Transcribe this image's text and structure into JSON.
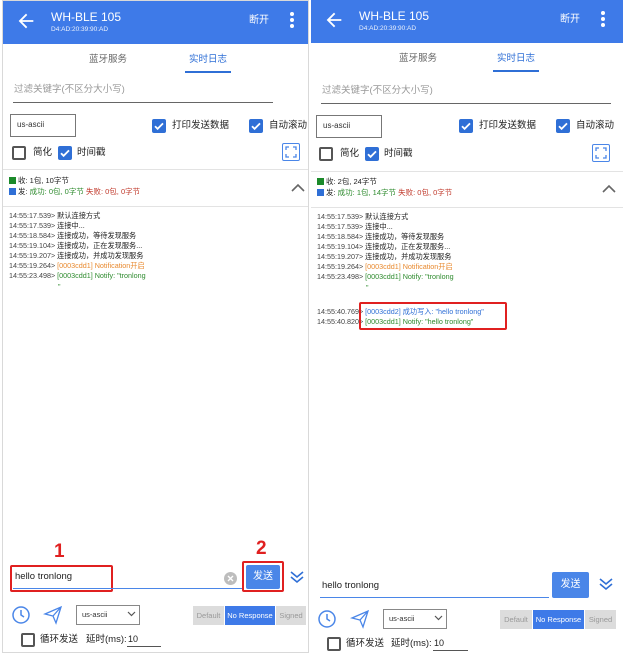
{
  "device": {
    "name": "WH-BLE 105",
    "mac": "D4:AD:20:39:90:AD",
    "disconnect_label": "断开"
  },
  "tabs": [
    {
      "label": "蓝牙服务"
    },
    {
      "label": "实时日志"
    }
  ],
  "active_tab": "实时日志",
  "filter": {
    "placeholder": "过滤关键字(不区分大小写)"
  },
  "encoding": "us-ascii",
  "options": {
    "print_send": "打印发送数据",
    "auto_scroll": "自动滚动",
    "simplify": "简化",
    "timestamp": "时间戳"
  },
  "colors": {
    "accent": "#3e7ae8",
    "success": "#2e8b2e",
    "error": "#c0392b",
    "notify_orange": "#e8892e",
    "highlight": "#e02020"
  },
  "left": {
    "stats": {
      "recv_prefix": "收: ",
      "recv_value": "1包, 10字节",
      "send_prefix": "发: ",
      "send_ok": "成功: 0包, 0字节",
      "send_fail": "失败: 0包, 0字节"
    },
    "logs": [
      {
        "time": "14:55:17.539>",
        "text": "默认连接方式",
        "color": "blk"
      },
      {
        "time": "14:55:17.539>",
        "text": "连接中...",
        "color": "blk"
      },
      {
        "time": "14:55:18.584>",
        "text": "连接成功，等待发现服务",
        "color": "blk"
      },
      {
        "time": "14:55:19.104>",
        "text": "连接成功，正在发现服务...",
        "color": "blk"
      },
      {
        "time": "14:55:19.207>",
        "text": "连接成功，并成功发现服务",
        "color": "blk"
      },
      {
        "time": "14:55:19.264>",
        "text": "[0003cdd1] Notification开启",
        "color": "orn"
      },
      {
        "time": "14:55:23.498>",
        "text": "[0003cdd1] Notify: \"tronlong",
        "color": "grn"
      }
    ],
    "input_value": "hello tronlong",
    "send_label": "发送",
    "marker_1": "1",
    "marker_2": "2"
  },
  "right": {
    "stats": {
      "recv_prefix": "收: ",
      "recv_value": "2包, 24字节",
      "send_prefix": "发: ",
      "send_ok": "成功: 1包, 14字节",
      "send_fail": "失败: 0包, 0字节"
    },
    "logs": [
      {
        "time": "14:55:17.539>",
        "text": "默认连接方式",
        "color": "blk"
      },
      {
        "time": "14:55:17.539>",
        "text": "连接中...",
        "color": "blk"
      },
      {
        "time": "14:55:18.584>",
        "text": "连接成功，等待发现服务",
        "color": "blk"
      },
      {
        "time": "14:55:19.104>",
        "text": "连接成功，正在发现服务...",
        "color": "blk"
      },
      {
        "time": "14:55:19.207>",
        "text": "连接成功，并成功发现服务",
        "color": "blk"
      },
      {
        "time": "14:55:19.264>",
        "text": "[0003cdd1] Notification开启",
        "color": "orn"
      },
      {
        "time": "14:55:23.498>",
        "text": "[0003cdd1] Notify: \"tronlong",
        "color": "grn"
      }
    ],
    "new_logs": [
      {
        "time": "14:55:40.769>",
        "text": "[0003cdd2] 成功写入: \"hello tronlong\"",
        "color": "blu"
      },
      {
        "time": "14:55:40.820>",
        "text": "[0003cdd1] Notify: \"hello tronlong\"",
        "color": "grn"
      }
    ],
    "input_value": "hello tronlong",
    "send_label": "发送"
  },
  "write_types": [
    "Default",
    "No Response",
    "Signed"
  ],
  "selected_write_type": "No Response",
  "loop_send": "循环发送",
  "delay_label": "延时(ms):",
  "delay_value": "10",
  "dot": "\""
}
